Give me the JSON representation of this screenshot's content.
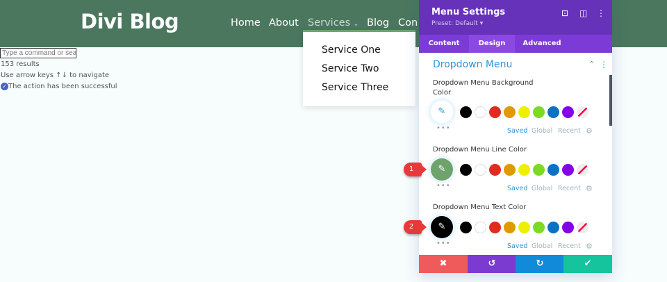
{
  "site": {
    "logo": "Divi Blog",
    "nav": [
      "Home",
      "About",
      "Services",
      "Blog",
      "Con"
    ],
    "services_chevron": "⌄",
    "dropdown": [
      "Service One",
      "Service Two",
      "Service Three"
    ]
  },
  "command": {
    "placeholder": "Type a command or search",
    "results": "153 results",
    "hint": "Use arrow keys ↑↓ to navigate",
    "success": "The action has been successful"
  },
  "panel": {
    "title": "Menu Settings",
    "preset": "Preset: Default ▾",
    "tabs": [
      "Content",
      "Design",
      "Advanced"
    ],
    "active_tab": "Design",
    "section": "Dropdown Menu",
    "fields": [
      {
        "label": "Dropdown Menu Background Color",
        "value_color": "#ffffff",
        "badge": ""
      },
      {
        "label": "Dropdown Menu Line Color",
        "value_color": "#6ea36c",
        "badge": "1"
      },
      {
        "label": "Dropdown Menu Text Color",
        "value_color": "#000000",
        "badge": "2"
      }
    ],
    "swatches": [
      "#000000",
      "#ffffff",
      "#e02b20",
      "#e09900",
      "#edf000",
      "#7cda24",
      "#0c71c3",
      "#8300e9"
    ],
    "links": {
      "saved": "Saved",
      "global": "Global",
      "recent": "Recent"
    },
    "footer": {
      "cancel": "✖",
      "undo": "↺",
      "redo": "↻",
      "save": "✔"
    }
  },
  "colors": {
    "header": "#4a775e",
    "panel_header": "#6632b9",
    "accent": "#2d96d9"
  }
}
